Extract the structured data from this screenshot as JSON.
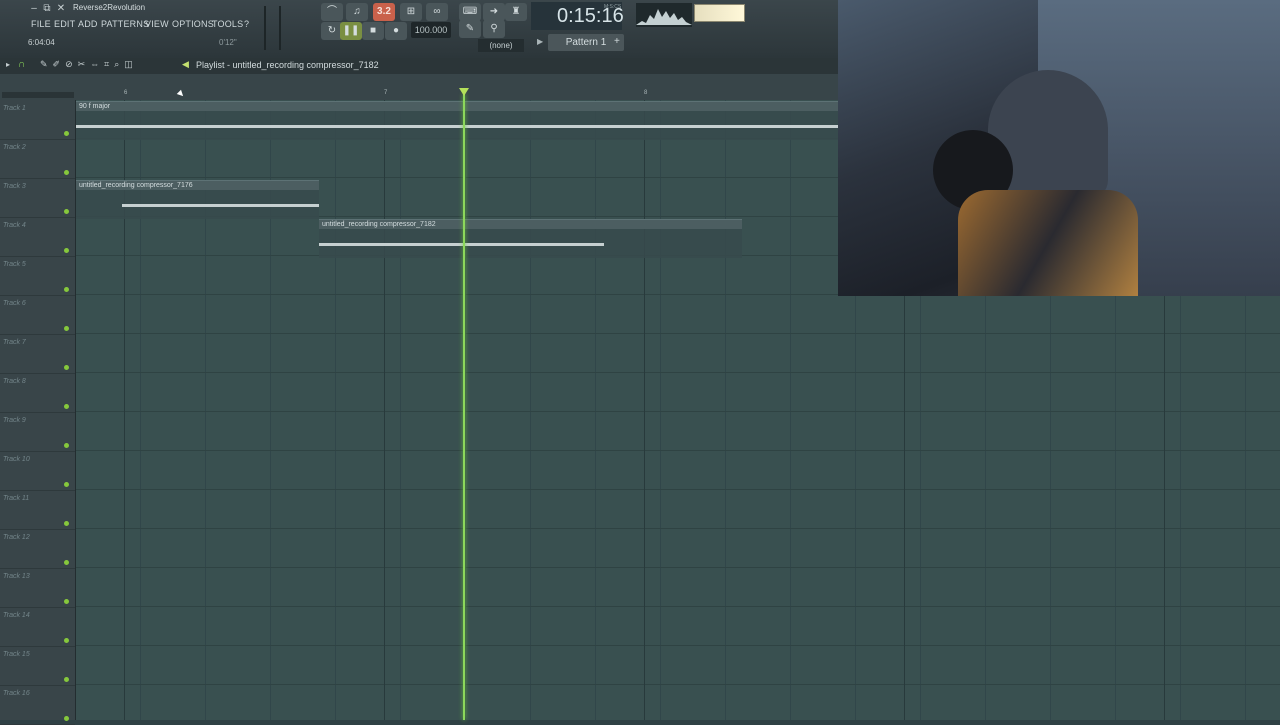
{
  "app": {
    "title": "Reverse2Revolution",
    "window_controls": [
      "–",
      "⧉",
      "✕"
    ]
  },
  "menu": [
    "FILE",
    "EDIT",
    "ADD",
    "PATTERNS",
    "VIEW",
    "OPTIONS",
    "TOOLS",
    "?"
  ],
  "hint": {
    "left": "6:04:04",
    "right": "0'12\""
  },
  "transport": {
    "record_label": "3.2",
    "tempo": "100.000",
    "time": "0:15:16",
    "time_unit": "M:S:CS",
    "snap": "(none)",
    "pattern": "Pattern 1"
  },
  "playlist": {
    "title": "Playlist - untitled_recording compressor_7182",
    "ruler_numbers": [
      "6",
      "7",
      "8"
    ],
    "tracks": [
      "Track 1",
      "Track 2",
      "Track 3",
      "Track 4",
      "Track 5",
      "Track 6",
      "Track 7",
      "Track 8",
      "Track 9",
      "Track 10",
      "Track 11",
      "Track 12",
      "Track 13",
      "Track 14",
      "Track 15",
      "Track 16"
    ],
    "clips": [
      {
        "label": "90 f major"
      },
      {
        "label": "untitled_recording compressor_7176"
      },
      {
        "label": "untitled_recording compressor_7182"
      }
    ]
  },
  "colors": {
    "accent": "#8cd85b",
    "record": "#c9614b",
    "grid": "#395050"
  }
}
